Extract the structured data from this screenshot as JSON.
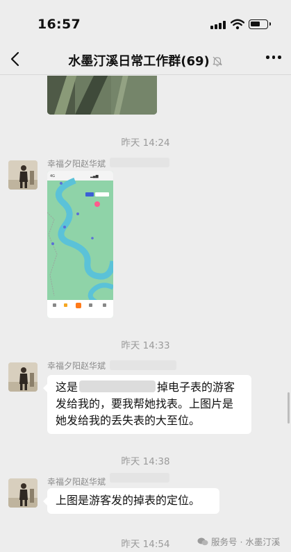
{
  "status_bar": {
    "time": "16:57",
    "battery_level": 0.6
  },
  "header": {
    "title": "水墨汀溪日常工作群(69)",
    "back_icon": "chevron-left-icon",
    "mute_icon": "bell-off-icon",
    "more_icon": "more-dots-icon"
  },
  "messages": [
    {
      "timestamp": "昨天 14:24",
      "sender": "幸福夕阳赵华斌",
      "type": "image",
      "content": "map-screenshot"
    },
    {
      "timestamp": "昨天 14:33",
      "sender": "幸福夕阳赵华斌",
      "type": "text",
      "text_before": "这是",
      "text_after": "掉电子表的游客发给我的，要我帮她找表。上图片是她发给我的丢失表的大至位。"
    },
    {
      "timestamp": "昨天 14:38",
      "sender": "幸福夕阳赵华斌",
      "type": "text",
      "text": "上图是游客发的掉表的定位。"
    },
    {
      "timestamp": "昨天 14:54"
    }
  ],
  "watermark": {
    "text": "服务号 · 水墨汀溪"
  },
  "colors": {
    "background": "#ededed",
    "bubble": "#ffffff",
    "timestamp": "#9a9a9a",
    "map_water": "#5bc2d8",
    "map_land": "#8fd3a8"
  }
}
